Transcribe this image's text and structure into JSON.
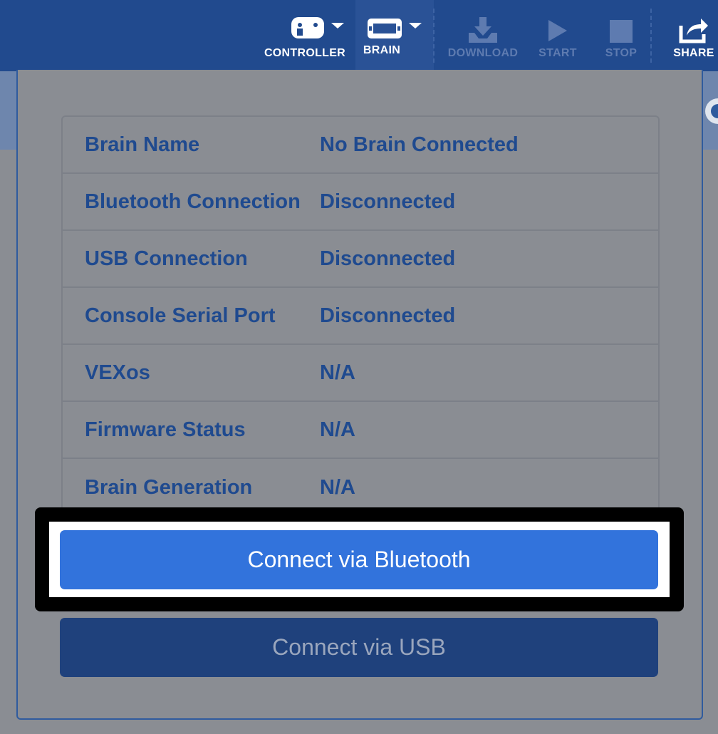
{
  "toolbar": {
    "controller_label": "CONTROLLER",
    "brain_label": "BRAIN",
    "download_label": "DOWNLOAD",
    "start_label": "START",
    "stop_label": "STOP",
    "share_label": "SHARE",
    "icons": [
      "gamepad-icon",
      "brain-icon",
      "download-icon",
      "play-icon",
      "stop-icon",
      "share-icon"
    ]
  },
  "brain_info": {
    "rows": [
      {
        "label": "Brain Name",
        "value": "No Brain Connected"
      },
      {
        "label": "Bluetooth Connection",
        "value": "Disconnected"
      },
      {
        "label": "USB Connection",
        "value": "Disconnected"
      },
      {
        "label": "Console Serial Port",
        "value": "Disconnected"
      },
      {
        "label": "VEXos",
        "value": "N/A"
      },
      {
        "label": "Firmware Status",
        "value": "N/A"
      },
      {
        "label": "Brain Generation",
        "value": "N/A"
      }
    ]
  },
  "buttons": {
    "bluetooth_label": "Connect via Bluetooth",
    "usb_label": "Connect via USB"
  },
  "colors": {
    "toolbar_bg": "#214a8e",
    "primary_button": "#3273dc",
    "secondary_button": "#1f417c",
    "text_blue": "#1f4a8f",
    "highlight_frame": "#000000"
  }
}
